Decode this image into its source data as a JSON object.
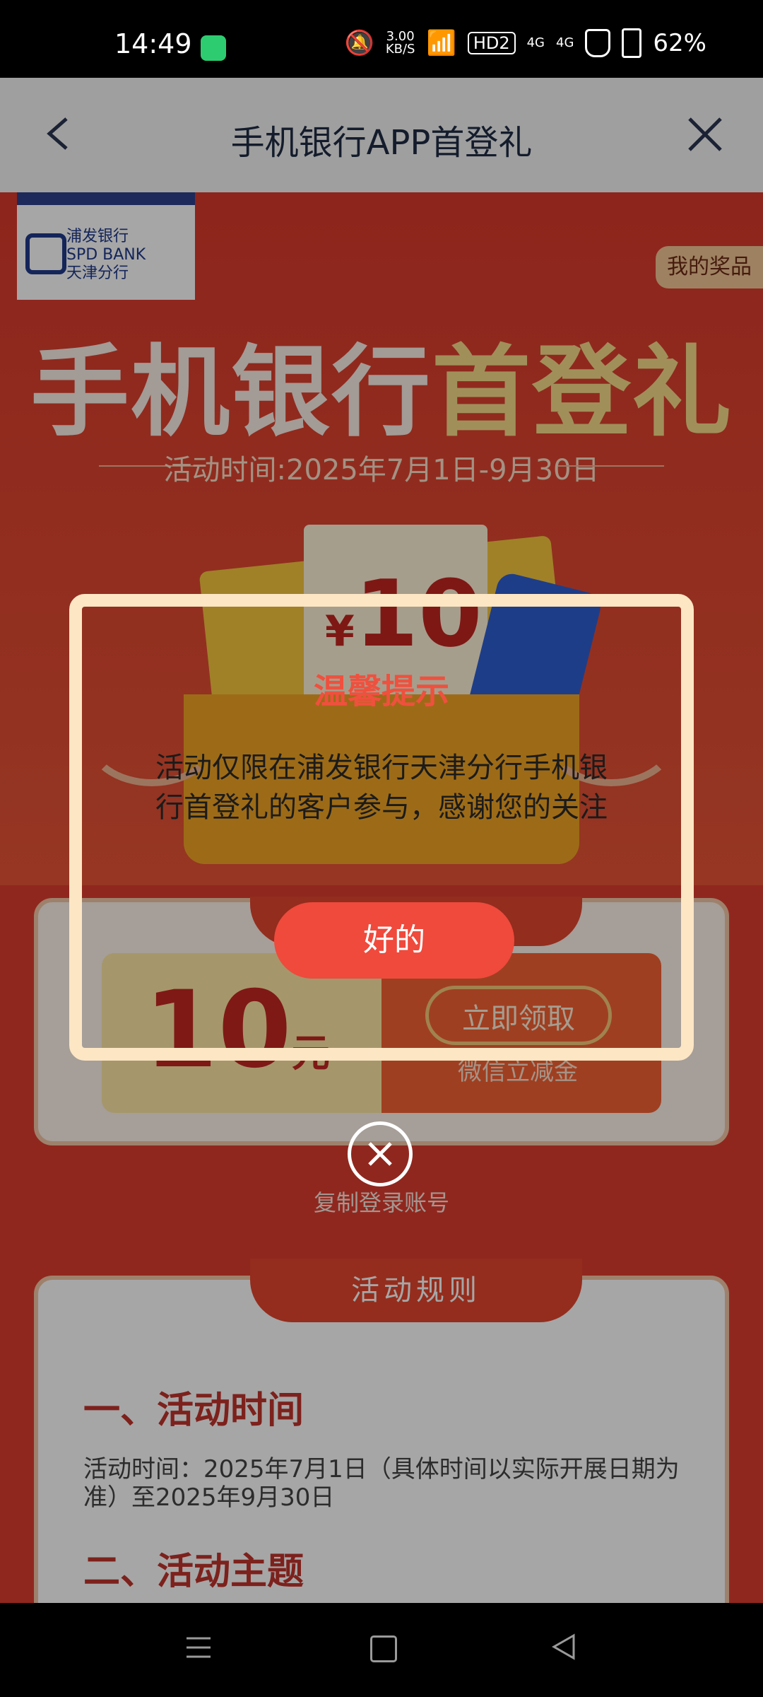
{
  "status_bar": {
    "time": "14:49",
    "net_speed": "3.00",
    "net_unit": "KB/S",
    "hd": "HD2",
    "sig1": "4G",
    "sig2": "4G",
    "battery": "62%"
  },
  "header": {
    "title": "手机银行APP首登礼"
  },
  "hero": {
    "logo_cn": "浦发银行",
    "logo_en": "SPD BANK",
    "logo_branch": "天津分行",
    "prize_button": "我的奖品",
    "title_white": "手机银行",
    "title_gold": "首登礼",
    "date": "活动时间:2025年7月1日-9月30日",
    "envelope_currency": "¥",
    "envelope_amount": "10"
  },
  "coupon": {
    "amount": "10",
    "unit": "元",
    "claim_button": "立即领取",
    "subtitle": "微信立减金"
  },
  "copy_account": "复制登录账号",
  "rules": {
    "tab": "活动规则",
    "section1_title": "一、活动时间",
    "section1_text": "活动时间：2025年7月1日（具体时间以实际开展日期为准）至2025年9月30日",
    "section2_title": "二、活动主题"
  },
  "dialog": {
    "title": "温馨提示",
    "body": "活动仅限在浦发银行天津分行手机银行首登礼的客户参与，感谢您的关注",
    "ok_button": "好的"
  }
}
